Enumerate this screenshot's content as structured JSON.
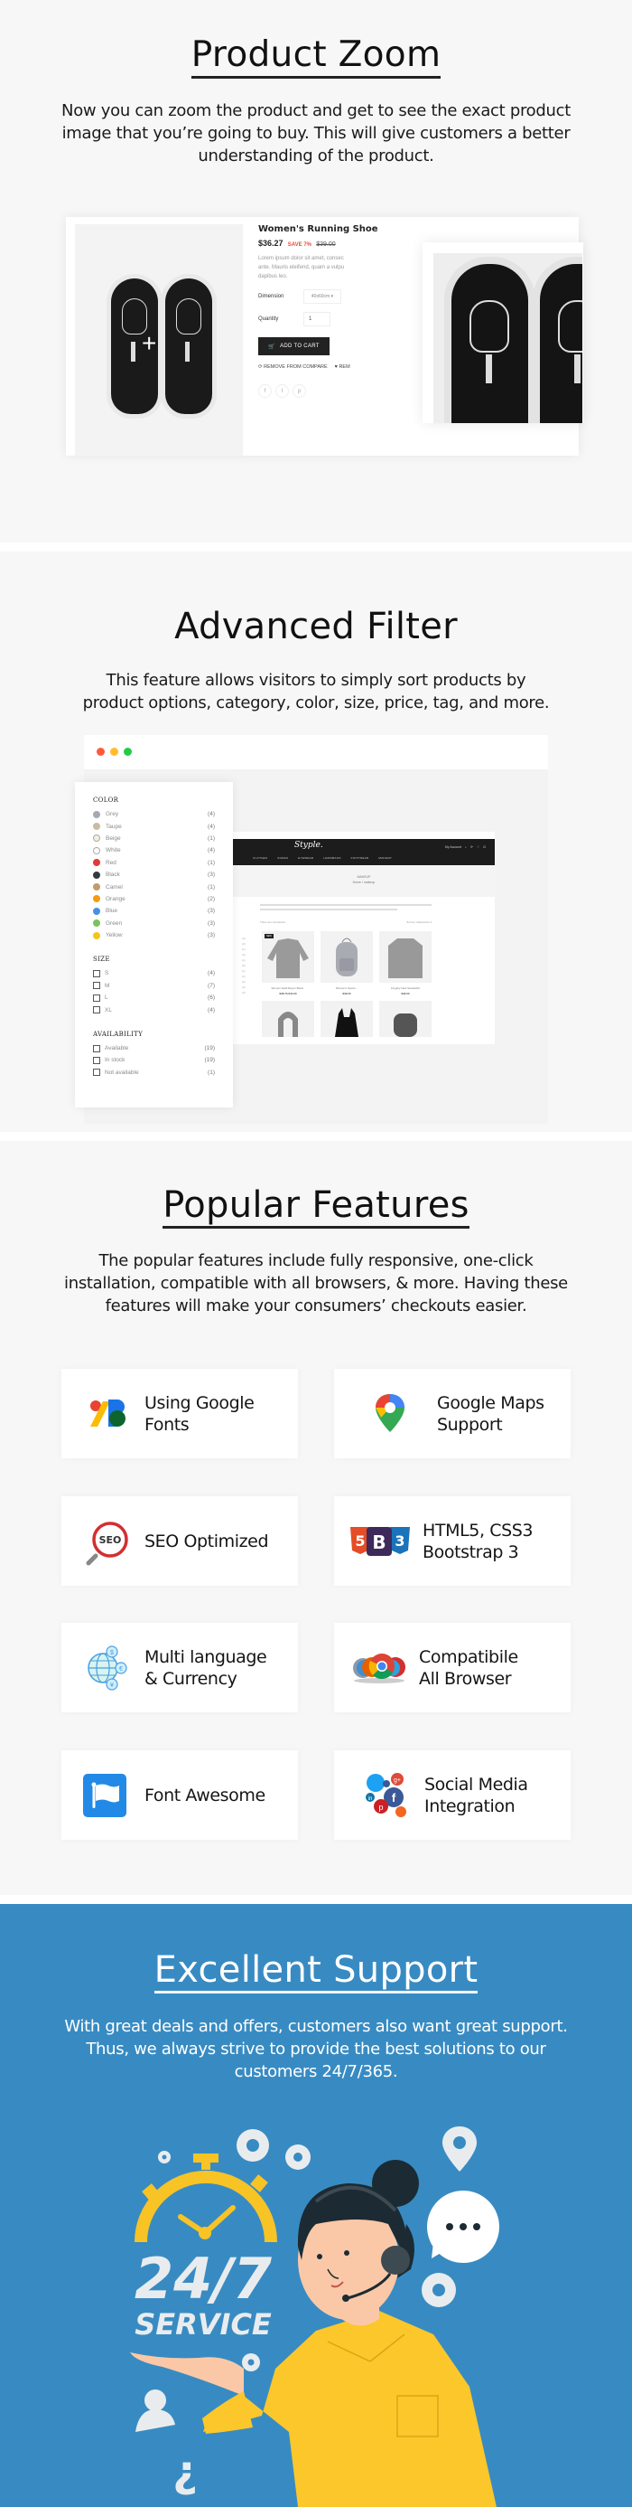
{
  "product_zoom": {
    "title": "Product Zoom",
    "description": "Now you can zoom the product and get to see the exact product image that you’re going to buy. This will give customers a better understanding of the product.",
    "product": {
      "name": "Women's Running Shoe",
      "price": "$36.27",
      "save_badge": "SAVE 7%",
      "old_price": "$39.00",
      "lorem_lines": [
        "Lorem ipsum dolor sit amet, consec",
        "ante. Mauris eleifend, quam a vulpu",
        "dapibus leo."
      ],
      "dimension_label": "Dimension",
      "dimension_value": "40x60cm",
      "quantity_label": "Quantity",
      "quantity_value": "1",
      "add_to_cart": "ADD TO CART",
      "remove_compare": "REMOVE FROM COMPARE",
      "wishlist": "REM",
      "social": [
        "f",
        "t",
        "p"
      ]
    }
  },
  "advanced_filter": {
    "title": "Advanced Filter",
    "description": "This feature allows visitors to simply sort products by product options, category, color, size, price, tag, and more.",
    "window_dots": [
      "#ff5a3c",
      "#ffbd2e",
      "#22cc44"
    ],
    "filters": {
      "color": {
        "heading": "COLOR",
        "items": [
          {
            "name": "Grey",
            "count": "(4)",
            "swatch": "#a4a9b3"
          },
          {
            "name": "Taupe",
            "count": "(4)",
            "swatch": "#c9bca0"
          },
          {
            "name": "Beige",
            "count": "(1)",
            "swatch": "#f5f0d6"
          },
          {
            "name": "White",
            "count": "(4)",
            "swatch": "#ffffff"
          },
          {
            "name": "Red",
            "count": "(1)",
            "swatch": "#e03a3a"
          },
          {
            "name": "Black",
            "count": "(3)",
            "swatch": "#343a40"
          },
          {
            "name": "Camel",
            "count": "(1)",
            "swatch": "#c29a6b"
          },
          {
            "name": "Orange",
            "count": "(2)",
            "swatch": "#f39c12"
          },
          {
            "name": "Blue",
            "count": "(3)",
            "swatch": "#4a90e2"
          },
          {
            "name": "Green",
            "count": "(3)",
            "swatch": "#7dc15a"
          },
          {
            "name": "Yellow",
            "count": "(3)",
            "swatch": "#f5c518"
          }
        ]
      },
      "size": {
        "heading": "SIZE",
        "items": [
          {
            "name": "S",
            "count": "(4)"
          },
          {
            "name": "M",
            "count": "(7)"
          },
          {
            "name": "L",
            "count": "(6)"
          },
          {
            "name": "XL",
            "count": "(4)"
          }
        ]
      },
      "availability": {
        "heading": "AVAILABILITY",
        "items": [
          {
            "name": "Available",
            "count": "(19)"
          },
          {
            "name": "In stock",
            "count": "(19)"
          },
          {
            "name": "Not available",
            "count": "(1)"
          }
        ]
      }
    },
    "shop": {
      "logo": "Styple.",
      "menu": [
        "CLOTHES",
        "SHOES",
        "EYEWEAR",
        "HANDBAGS",
        "FOOTWEAR",
        "MAKEUP"
      ],
      "account": "My Account",
      "page_title": "MAKEUP",
      "breadcrumb": "Home / makeup",
      "toolbar_count": "There are 9 products.",
      "sort_label": "Sort by:",
      "sort_value": "Relevance",
      "products": [
        {
          "title": "Women Solid Rayon Barat..",
          "price": "$38.73 $44.00",
          "badge": "NEW"
        },
        {
          "title": "Women's Sports...",
          "price": "$39.00"
        },
        {
          "title": "Integrity New Sweatshirt",
          "price": "$39.00"
        },
        {
          "title": "",
          "price": ""
        },
        {
          "title": "",
          "price": ""
        },
        {
          "title": "",
          "price": ""
        }
      ]
    }
  },
  "popular_features": {
    "title": "Popular Features",
    "description": "The popular features include  fully responsive, one-click installation, compatible with all browsers, & more. Having these features will make your consumers’ checkouts easier.",
    "items": [
      {
        "label": "Using Google\nFonts",
        "icon": "google-fonts-icon"
      },
      {
        "label": "Google Maps\nSupport",
        "icon": "google-maps-icon"
      },
      {
        "label": "SEO Optimized",
        "icon": "seo-icon"
      },
      {
        "label": "HTML5, CSS3\nBootstrap 3",
        "icon": "html5-css3-bootstrap-icon"
      },
      {
        "label": "Multi language\n& Currency",
        "icon": "globe-currency-icon"
      },
      {
        "label": "Compatibile\nAll Browser",
        "icon": "browsers-icon"
      },
      {
        "label": "Font Awesome",
        "icon": "font-awesome-flag-icon"
      },
      {
        "label": "Social Media\nIntegration",
        "icon": "social-media-icon"
      }
    ]
  },
  "excellent_support": {
    "title": "Excellent Support",
    "description": "With great deals and offers, customers also want great support. Thus, we always strive to provide the best solutions to our customers 24/7/365.",
    "illustration": {
      "big_text": "24/7",
      "sub_text": "SERVICE",
      "colors": {
        "background": "#388bc2",
        "accent": "#f7c325",
        "shirt": "#fcc72a",
        "hair": "#1c2b33",
        "skin": "#fbc8a7",
        "icons": "#e9ecef"
      }
    }
  }
}
